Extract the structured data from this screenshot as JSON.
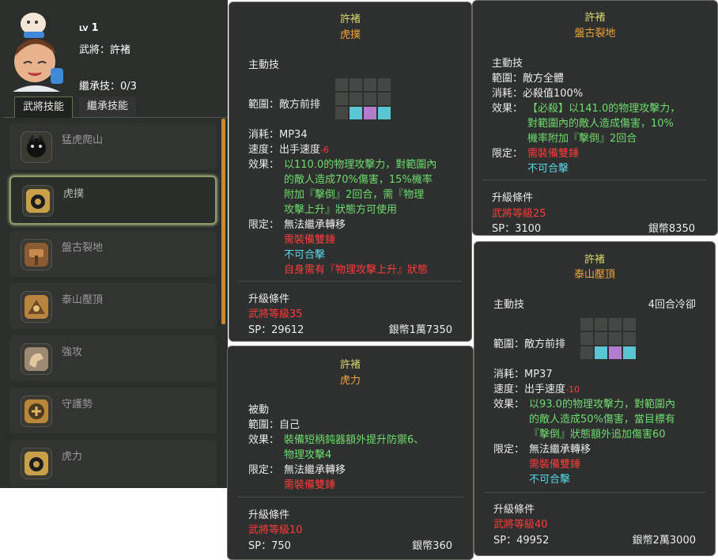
{
  "header": {
    "lv_prefix": "LV",
    "lv_value": "1",
    "general": "武將：許褚",
    "inherit": "繼承技：0/3"
  },
  "tabs": [
    "武將技能",
    "繼承技能"
  ],
  "skills": [
    {
      "label": "猛虎爬山"
    },
    {
      "label": "虎撲"
    },
    {
      "label": "盤古裂地"
    },
    {
      "label": "泰山壓頂"
    },
    {
      "label": "強攻"
    },
    {
      "label": "守護勢"
    },
    {
      "label": "虎力"
    }
  ],
  "tip_hupu": {
    "name": "許褚",
    "skill": "虎撲",
    "type": "主動技",
    "range": "範圍：敵方前排",
    "cost": "消耗：MP34",
    "speed_label": "速度：出手速度",
    "speed_val": "-6",
    "effect_label": "效果：",
    "effect1": "以110.0的物理攻擊力，對範圍內",
    "effect2": "的敵人造成70%傷害，15%機率",
    "effect3": "附加『擊倒』2回合，需『物理",
    "effect4": "攻擊上升』狀態方可使用",
    "limit_label": "限定：",
    "limit1": "無法繼承轉移",
    "limit2": "需裝備雙錘",
    "limit3": "不可合擊",
    "limit4": "自身需有『物理攻擊上升』狀態",
    "upgrade": "升級條件",
    "req": "武將等級35",
    "sp": "SP：29612",
    "silver": "銀幣1萬7350"
  },
  "tip_huli": {
    "name": "許褚",
    "skill": "虎力",
    "type": "被動",
    "range": "範圍：自己",
    "effect_label": "效果：",
    "effect1": "裝備短柄鈍器額外提升防禦6、",
    "effect2": "物理攻擊4",
    "limit_label": "限定：",
    "limit1": "無法繼承轉移",
    "limit2": "需裝備雙錘",
    "upgrade": "升級條件",
    "req": "武將等級10",
    "sp": "SP：750",
    "silver": "銀幣360"
  },
  "tip_pangu": {
    "name": "許褚",
    "skill": "盤古裂地",
    "type": "主動技",
    "range": "範圍：敵方全體",
    "cost": "消耗：必殺值100%",
    "effect_label": "效果：",
    "effect1": "【必殺】以141.0的物理攻擊力，",
    "effect2": "對範圍內的敵人造成傷害，10%",
    "effect3": "機率附加『擊倒』2回合",
    "limit_label": "限定：",
    "limit1": "需裝備雙錘",
    "limit2": "不可合擊",
    "upgrade": "升級條件",
    "req": "武將等級25",
    "sp": "SP：3100",
    "silver": "銀幣8350"
  },
  "tip_taishan": {
    "name": "許褚",
    "skill": "泰山壓頂",
    "type": "主動技",
    "cooldown": "4回合冷卻",
    "range": "範圍：敵方前排",
    "cost": "消耗：MP37",
    "speed_label": "速度：出手速度",
    "speed_val": "-10",
    "effect_label": "效果：",
    "effect1": "以93.0的物理攻擊力，對範圍內",
    "effect2": "的敵人造成50%傷害，當目標有",
    "effect3": "『擊倒』狀態額外追加傷害60",
    "limit_label": "限定：",
    "limit1": "無法繼承轉移",
    "limit2": "需裝備雙錘",
    "limit3": "不可合擊",
    "upgrade": "升級條件",
    "req": "武將等級40",
    "sp": "SP：49952",
    "silver": "銀幣2萬3000"
  },
  "colors": {
    "panel": "#2d302e",
    "name": "#d8d36e",
    "skill": "#f1a43a",
    "green": "#6fdc6f",
    "red": "#ff3b3b",
    "cyan": "#58d6e8"
  }
}
